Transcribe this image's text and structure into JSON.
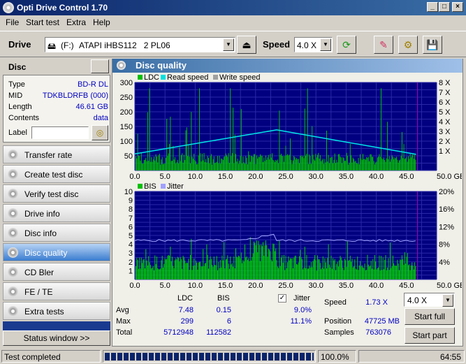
{
  "window": {
    "title": "Opti Drive Control 1.70"
  },
  "menu": [
    "File",
    "Start test",
    "Extra",
    "Help"
  ],
  "toolbar": {
    "drive_label": "Drive",
    "drive_letter": "(F:)",
    "drive_name": "ATAPI iHBS112   2 PL06",
    "speed_label": "Speed",
    "speed_value": "4.0 X"
  },
  "disc": {
    "header": "Disc",
    "rows": [
      {
        "label": "Type",
        "value": "BD-R DL"
      },
      {
        "label": "MID",
        "value": "TDKBLDRFB (000)"
      },
      {
        "label": "Length",
        "value": "46.61 GB"
      },
      {
        "label": "Contents",
        "value": "data"
      }
    ],
    "label_field": "Label"
  },
  "nav": [
    {
      "label": "Transfer rate",
      "active": false
    },
    {
      "label": "Create test disc",
      "active": false
    },
    {
      "label": "Verify test disc",
      "active": false
    },
    {
      "label": "Drive info",
      "active": false
    },
    {
      "label": "Disc info",
      "active": false
    },
    {
      "label": "Disc quality",
      "active": true
    },
    {
      "label": "CD Bler",
      "active": false
    },
    {
      "label": "FE / TE",
      "active": false
    },
    {
      "label": "Extra tests",
      "active": false
    }
  ],
  "status_window_btn": "Status window >>",
  "panel_title": "Disc quality",
  "chart_data": [
    {
      "type": "area",
      "legend": [
        "LDC",
        "Read speed",
        "Write speed"
      ],
      "colors": {
        "LDC": "#00c000",
        "Read speed": "#00e0e0",
        "Write speed": "#a0a0a0"
      },
      "x_ticks": [
        "0.0",
        "5.0",
        "10.0",
        "15.0",
        "20.0",
        "25.0",
        "30.0",
        "35.0",
        "40.0",
        "45.0",
        "50.0 GB"
      ],
      "y_left_ticks": [
        "300",
        "250",
        "200",
        "150",
        "100",
        "50"
      ],
      "y_right_ticks": [
        "8 X",
        "7 X",
        "6 X",
        "5 X",
        "4 X",
        "3 X",
        "2 X",
        "1 X"
      ],
      "xlim": [
        0,
        50
      ],
      "ylim": [
        0,
        300
      ],
      "read_speed": {
        "x": [
          0,
          23.5,
          46.6
        ],
        "y": [
          1.7,
          4.15,
          1.65
        ]
      }
    },
    {
      "type": "area",
      "legend": [
        "BIS",
        "Jitter"
      ],
      "colors": {
        "BIS": "#00c000",
        "Jitter": "#a0a0ff"
      },
      "x_ticks": [
        "0.0",
        "5.0",
        "10.0",
        "15.0",
        "20.0",
        "25.0",
        "30.0",
        "35.0",
        "40.0",
        "45.0",
        "50.0 GB"
      ],
      "y_left_ticks": [
        "10",
        "9",
        "8",
        "7",
        "6",
        "5",
        "4",
        "3",
        "2",
        "1"
      ],
      "y_right_ticks": [
        "20%",
        "16%",
        "12%",
        "8%",
        "4%"
      ],
      "xlim": [
        0,
        50
      ],
      "ylim": [
        0,
        10
      ]
    }
  ],
  "stats": {
    "col_ldc": "LDC",
    "col_bis": "BIS",
    "jitter_label": "Jitter",
    "rows": [
      {
        "label": "Avg",
        "ldc": "7.48",
        "bis": "0.15",
        "jitter": "9.0%"
      },
      {
        "label": "Max",
        "ldc": "299",
        "bis": "6",
        "jitter": "11.1%"
      },
      {
        "label": "Total",
        "ldc": "5712948",
        "bis": "112582",
        "jitter": ""
      }
    ],
    "speed_label": "Speed",
    "speed_value": "1.73 X",
    "speed_select": "4.0 X",
    "position_label": "Position",
    "position_value": "47725 MB",
    "samples_label": "Samples",
    "samples_value": "763076",
    "start_full": "Start full",
    "start_part": "Start part"
  },
  "status": {
    "text": "Test completed",
    "progress_pct": "100.0%",
    "progress": 1.0,
    "time": "64:55"
  }
}
